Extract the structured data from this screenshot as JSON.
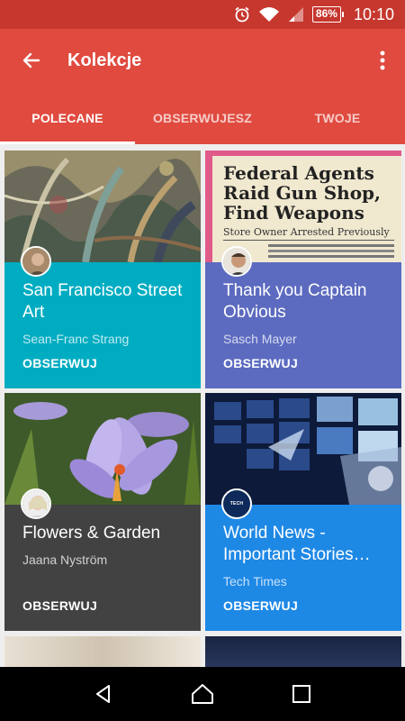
{
  "status_bar": {
    "battery": "86%",
    "time": "10:10"
  },
  "app_bar": {
    "title": "Kolekcje"
  },
  "tabs": [
    {
      "label": "POLECANE",
      "active": true
    },
    {
      "label": "OBSERWUJESZ",
      "active": false
    },
    {
      "label": "TWOJE",
      "active": false
    }
  ],
  "newspaper": {
    "headline_1": "Federal Agents",
    "headline_2": "Raid Gun Shop,",
    "headline_3": "Find Weapons",
    "subhead": "Store Owner Arrested Previously"
  },
  "cards": [
    {
      "title": "San Francisco Street Art",
      "author": "Sean-Franc Strang",
      "follow": "OBSERWUJ",
      "color": "#00acc1"
    },
    {
      "title": "Thank you Captain Obvious",
      "author": "Sasch Mayer",
      "follow": "OBSERWUJ",
      "color": "#5c6bc0"
    },
    {
      "title": "Flowers & Garden",
      "author": "Jaana Nyström",
      "follow": "OBSERWUJ",
      "color": "#424242"
    },
    {
      "title": "World News - Important Stories…",
      "author": "Tech Times",
      "follow": "OBSERWUJ",
      "color": "#1e88e5"
    }
  ],
  "tech_times_logo": "TECH TIMES"
}
